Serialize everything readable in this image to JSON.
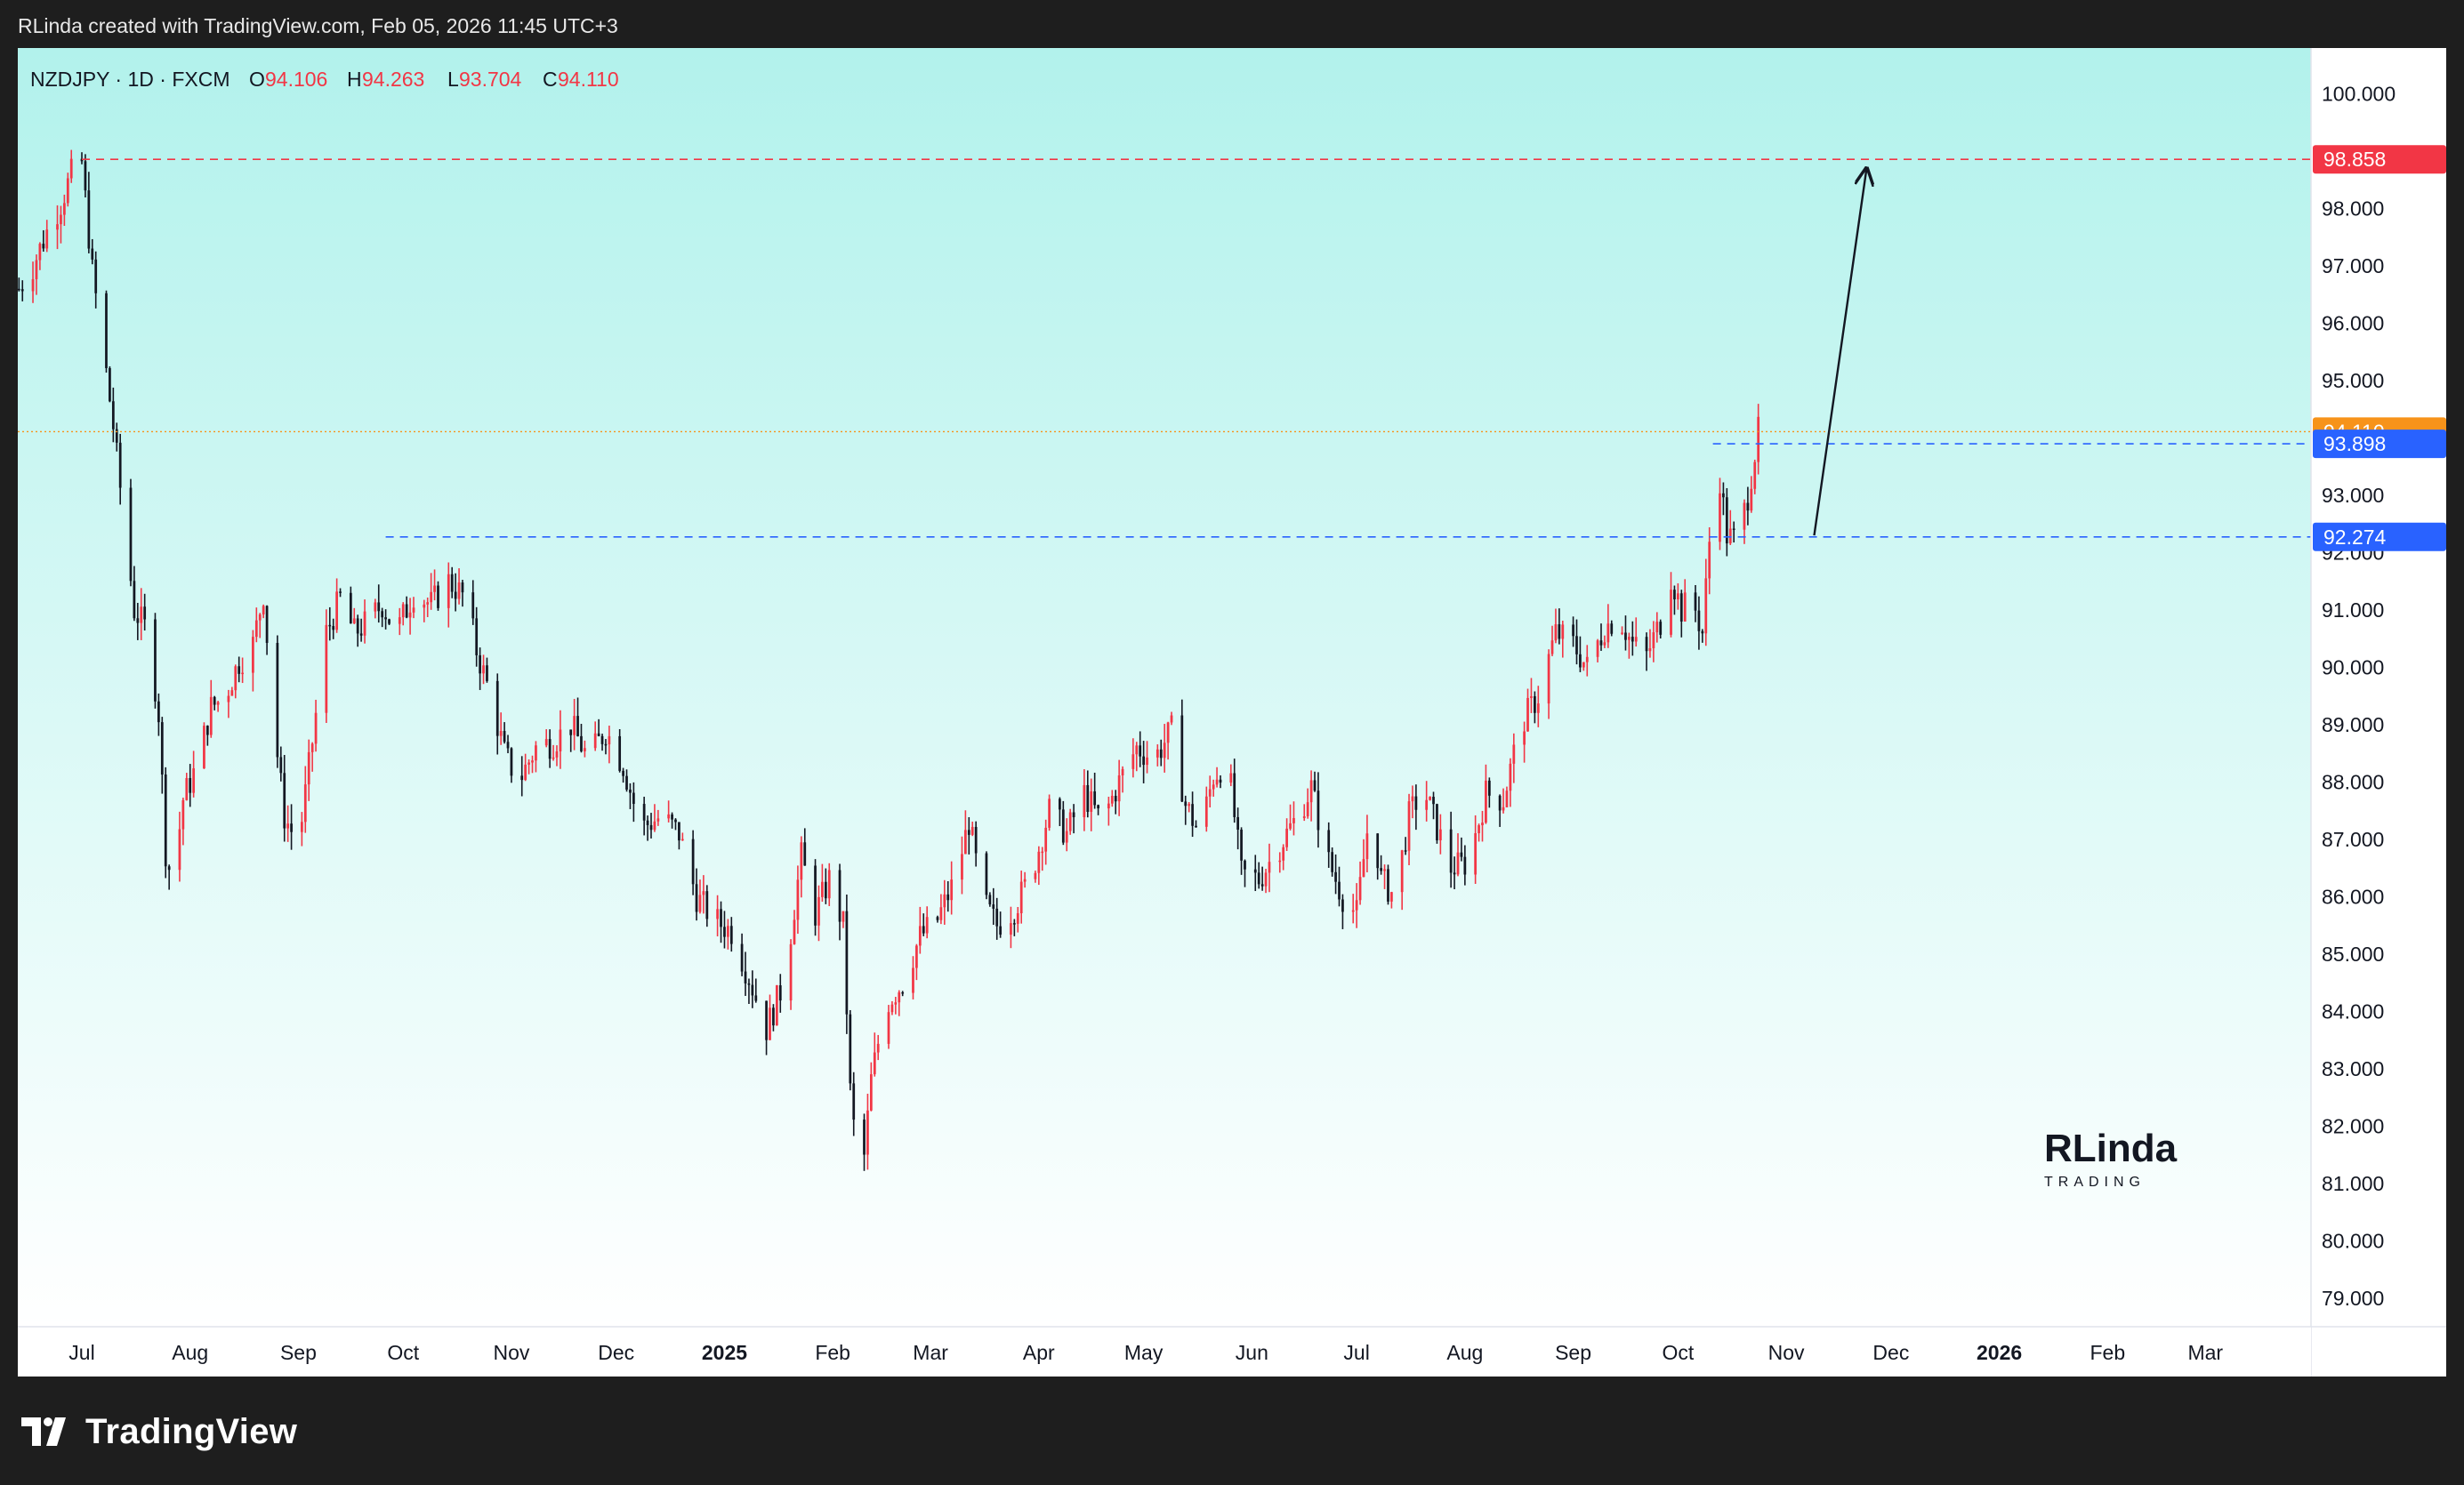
{
  "header": {
    "attribution": "RLinda created with TradingView.com, Feb 05, 2026 11:45 UTC+3"
  },
  "legend": {
    "symbol": "NZDJPY · 1D · FXCM",
    "o_label": "O",
    "o_value": "94.106",
    "h_label": "H",
    "h_value": "94.263",
    "l_label": "L",
    "l_value": "93.704",
    "c_label": "C",
    "c_value": "94.110"
  },
  "watermark": {
    "name": "RLinda",
    "sub": "TRADING"
  },
  "footer": {
    "brand": "TradingView"
  },
  "colors": {
    "up": "#f23645",
    "down": "#131722",
    "bg_top": "#b2f2ec",
    "bg_bottom": "#ffffff",
    "resistance": "#f23645",
    "support": "#2962ff",
    "last_price": "#f7931a"
  },
  "chart_data": {
    "type": "candlestick",
    "title": "NZDJPY · 1D · FXCM",
    "y_axis": {
      "side": "right",
      "ylim": [
        78.5,
        100.8
      ],
      "ticks": [
        "100.000",
        "98.000",
        "97.000",
        "96.000",
        "95.000",
        "93.000",
        "92.000",
        "91.000",
        "90.000",
        "89.000",
        "88.000",
        "87.000",
        "86.000",
        "85.000",
        "84.000",
        "83.000",
        "82.000",
        "81.000",
        "80.000",
        "79.000"
      ]
    },
    "x_axis": {
      "range_days": [
        0,
        625
      ],
      "labels": [
        {
          "text": "Jul",
          "day": 0,
          "bold": false
        },
        {
          "text": "Aug",
          "day": 31,
          "bold": false
        },
        {
          "text": "Sep",
          "day": 62,
          "bold": false
        },
        {
          "text": "Oct",
          "day": 92,
          "bold": false
        },
        {
          "text": "Nov",
          "day": 123,
          "bold": false
        },
        {
          "text": "Dec",
          "day": 153,
          "bold": false
        },
        {
          "text": "2025",
          "day": 184,
          "bold": true
        },
        {
          "text": "Feb",
          "day": 215,
          "bold": false
        },
        {
          "text": "Mar",
          "day": 243,
          "bold": false
        },
        {
          "text": "Apr",
          "day": 274,
          "bold": false
        },
        {
          "text": "May",
          "day": 304,
          "bold": false
        },
        {
          "text": "Jun",
          "day": 335,
          "bold": false
        },
        {
          "text": "Jul",
          "day": 365,
          "bold": false
        },
        {
          "text": "Aug",
          "day": 396,
          "bold": false
        },
        {
          "text": "Sep",
          "day": 427,
          "bold": false
        },
        {
          "text": "Oct",
          "day": 457,
          "bold": false
        },
        {
          "text": "Nov",
          "day": 488,
          "bold": false
        },
        {
          "text": "Dec",
          "day": 518,
          "bold": false
        },
        {
          "text": "2026",
          "day": 549,
          "bold": true
        },
        {
          "text": "Feb",
          "day": 580,
          "bold": false
        },
        {
          "text": "Mar",
          "day": 608,
          "bold": false
        }
      ]
    },
    "price_path": [
      {
        "day": -18,
        "close": 96.6
      },
      {
        "day": -14,
        "close": 97.0
      },
      {
        "day": -10,
        "close": 97.6
      },
      {
        "day": -6,
        "close": 98.1
      },
      {
        "day": -3,
        "close": 98.6
      },
      {
        "day": 0,
        "close": 98.8
      },
      {
        "day": 3,
        "close": 96.9
      },
      {
        "day": 6,
        "close": 95.6
      },
      {
        "day": 9,
        "close": 94.2
      },
      {
        "day": 12,
        "close": 92.6
      },
      {
        "day": 15,
        "close": 91.0
      },
      {
        "day": 19,
        "close": 90.6
      },
      {
        "day": 22,
        "close": 89.2
      },
      {
        "day": 24,
        "close": 86.8
      },
      {
        "day": 26,
        "close": 86.2
      },
      {
        "day": 29,
        "close": 87.7
      },
      {
        "day": 33,
        "close": 88.3
      },
      {
        "day": 37,
        "close": 89.3
      },
      {
        "day": 41,
        "close": 89.5
      },
      {
        "day": 45,
        "close": 90.1
      },
      {
        "day": 49,
        "close": 90.4
      },
      {
        "day": 52,
        "close": 91.3
      },
      {
        "day": 55,
        "close": 89.0
      },
      {
        "day": 58,
        "close": 87.4
      },
      {
        "day": 62,
        "close": 86.9
      },
      {
        "day": 66,
        "close": 88.7
      },
      {
        "day": 70,
        "close": 90.6
      },
      {
        "day": 74,
        "close": 91.2
      },
      {
        "day": 78,
        "close": 90.6
      },
      {
        "day": 82,
        "close": 90.8
      },
      {
        "day": 86,
        "close": 91.1
      },
      {
        "day": 90,
        "close": 90.6
      },
      {
        "day": 95,
        "close": 91.3
      },
      {
        "day": 100,
        "close": 91.1
      },
      {
        "day": 105,
        "close": 91.5
      },
      {
        "day": 110,
        "close": 91.2
      },
      {
        "day": 113,
        "close": 90.3
      },
      {
        "day": 117,
        "close": 89.5
      },
      {
        "day": 121,
        "close": 88.5
      },
      {
        "day": 125,
        "close": 88.0
      },
      {
        "day": 130,
        "close": 88.6
      },
      {
        "day": 135,
        "close": 88.7
      },
      {
        "day": 140,
        "close": 89.0
      },
      {
        "day": 145,
        "close": 88.4
      },
      {
        "day": 150,
        "close": 88.9
      },
      {
        "day": 155,
        "close": 88.3
      },
      {
        "day": 160,
        "close": 87.2
      },
      {
        "day": 166,
        "close": 87.4
      },
      {
        "day": 171,
        "close": 87.1
      },
      {
        "day": 176,
        "close": 86.0
      },
      {
        "day": 181,
        "close": 85.6
      },
      {
        "day": 186,
        "close": 85.4
      },
      {
        "day": 191,
        "close": 84.6
      },
      {
        "day": 196,
        "close": 83.7
      },
      {
        "day": 201,
        "close": 84.5
      },
      {
        "day": 206,
        "close": 86.7
      },
      {
        "day": 210,
        "close": 85.7
      },
      {
        "day": 214,
        "close": 86.3
      },
      {
        "day": 218,
        "close": 85.5
      },
      {
        "day": 220,
        "close": 82.6
      },
      {
        "day": 223,
        "close": 80.8
      },
      {
        "day": 226,
        "close": 82.8
      },
      {
        "day": 230,
        "close": 84.1
      },
      {
        "day": 235,
        "close": 84.5
      },
      {
        "day": 240,
        "close": 85.3
      },
      {
        "day": 245,
        "close": 85.6
      },
      {
        "day": 250,
        "close": 86.3
      },
      {
        "day": 254,
        "close": 87.3
      },
      {
        "day": 258,
        "close": 85.9
      },
      {
        "day": 262,
        "close": 85.5
      },
      {
        "day": 267,
        "close": 85.8
      },
      {
        "day": 272,
        "close": 86.4
      },
      {
        "day": 277,
        "close": 87.5
      },
      {
        "day": 282,
        "close": 87.1
      },
      {
        "day": 287,
        "close": 87.8
      },
      {
        "day": 292,
        "close": 87.3
      },
      {
        "day": 297,
        "close": 88.0
      },
      {
        "day": 302,
        "close": 88.6
      },
      {
        "day": 307,
        "close": 88.4
      },
      {
        "day": 312,
        "close": 88.9
      },
      {
        "day": 316,
        "close": 87.6
      },
      {
        "day": 320,
        "close": 87.1
      },
      {
        "day": 324,
        "close": 88.1
      },
      {
        "day": 328,
        "close": 88.4
      },
      {
        "day": 332,
        "close": 86.4
      },
      {
        "day": 337,
        "close": 86.3
      },
      {
        "day": 342,
        "close": 86.8
      },
      {
        "day": 347,
        "close": 87.3
      },
      {
        "day": 352,
        "close": 87.9
      },
      {
        "day": 357,
        "close": 86.6
      },
      {
        "day": 361,
        "close": 86.0
      },
      {
        "day": 365,
        "close": 85.7
      },
      {
        "day": 369,
        "close": 87.6
      },
      {
        "day": 372,
        "close": 86.3
      },
      {
        "day": 376,
        "close": 86.0
      },
      {
        "day": 380,
        "close": 87.4
      },
      {
        "day": 384,
        "close": 87.9
      },
      {
        "day": 388,
        "close": 87.2
      },
      {
        "day": 392,
        "close": 86.5
      },
      {
        "day": 397,
        "close": 86.6
      },
      {
        "day": 402,
        "close": 87.8
      },
      {
        "day": 407,
        "close": 87.7
      },
      {
        "day": 412,
        "close": 89.0
      },
      {
        "day": 417,
        "close": 89.5
      },
      {
        "day": 422,
        "close": 90.6
      },
      {
        "day": 427,
        "close": 90.4
      },
      {
        "day": 431,
        "close": 90.0
      },
      {
        "day": 436,
        "close": 90.7
      },
      {
        "day": 440,
        "close": 90.9
      },
      {
        "day": 444,
        "close": 90.4
      },
      {
        "day": 448,
        "close": 90.2
      },
      {
        "day": 452,
        "close": 90.8
      },
      {
        "day": 455,
        "close": 91.6
      },
      {
        "day": 458,
        "close": 91.0
      },
      {
        "day": 461,
        "close": 91.2
      },
      {
        "day": 464,
        "close": 90.6
      },
      {
        "day": 468,
        "close": 93.8
      },
      {
        "day": 471,
        "close": 92.3
      },
      {
        "day": 474,
        "close": 92.2
      },
      {
        "day": 477,
        "close": 93.0
      },
      {
        "day": 480,
        "close": 94.1
      }
    ],
    "levels": [
      {
        "price": 98.858,
        "label": "98.858",
        "kind": "resistance",
        "start_day": 0
      },
      {
        "price": 93.898,
        "label": "93.898",
        "kind": "support",
        "start_day": 467
      },
      {
        "price": 92.274,
        "label": "92.274",
        "kind": "support",
        "start_day": 87
      }
    ],
    "last_price": {
      "price": 94.11,
      "label": "94.110"
    },
    "arrow": {
      "from_day": 496,
      "from_price": 92.3,
      "to_day": 511,
      "to_price": 98.7
    },
    "grid": false,
    "legend_position": "top-left"
  }
}
